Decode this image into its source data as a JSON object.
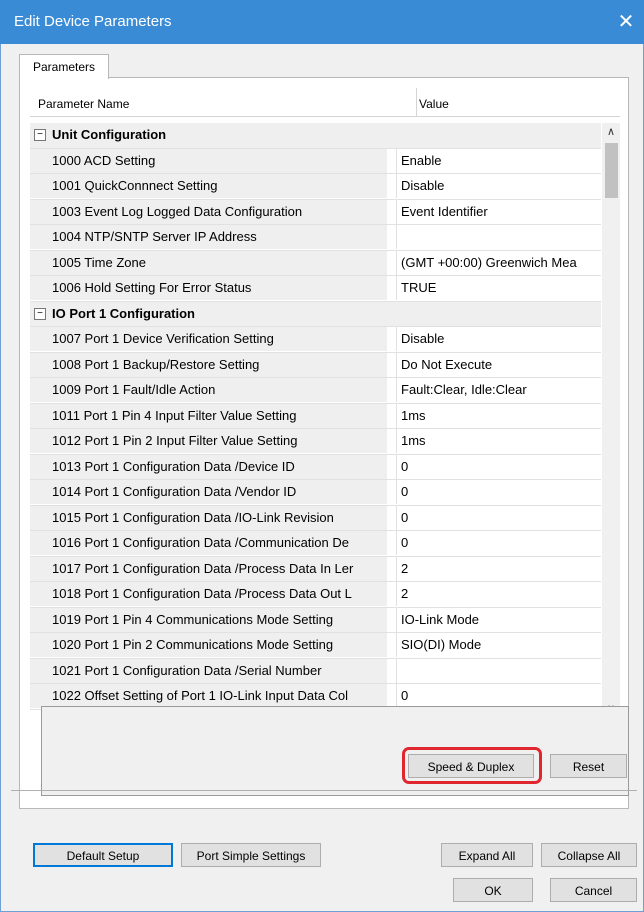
{
  "window": {
    "title": "Edit Device Parameters",
    "close_glyph": "✕"
  },
  "tab": {
    "label": "Parameters"
  },
  "grid": {
    "headers": {
      "name": "Parameter Name",
      "value": "Value"
    },
    "groups": [
      {
        "label": "Unit Configuration",
        "toggle": "−",
        "rows": [
          {
            "name": "1000 ACD Setting",
            "value": "Enable"
          },
          {
            "name": "1001 QuickConnnect Setting",
            "value": "Disable"
          },
          {
            "name": "1003 Event Log Logged Data Configuration",
            "value": "Event Identifier"
          },
          {
            "name": "1004 NTP/SNTP Server IP Address",
            "value": ""
          },
          {
            "name": "1005 Time Zone",
            "value": "(GMT +00:00) Greenwich Mea"
          },
          {
            "name": "1006 Hold Setting For Error Status",
            "value": "TRUE"
          }
        ]
      },
      {
        "label": "IO Port 1 Configuration",
        "toggle": "−",
        "rows": [
          {
            "name": "1007 Port 1 Device Verification Setting",
            "value": "Disable"
          },
          {
            "name": "1008 Port 1 Backup/Restore Setting",
            "value": "Do Not Execute"
          },
          {
            "name": "1009 Port 1 Fault/Idle Action",
            "value": "Fault:Clear, Idle:Clear"
          },
          {
            "name": "1011 Port 1 Pin 4 Input Filter Value Setting",
            "value": "1ms"
          },
          {
            "name": "1012 Port 1 Pin 2 Input Filter Value Setting",
            "value": "1ms"
          },
          {
            "name": "1013 Port 1 Configuration Data /Device ID",
            "value": "0"
          },
          {
            "name": "1014 Port 1 Configuration Data /Vendor ID",
            "value": "0"
          },
          {
            "name": "1015 Port 1 Configuration Data /IO-Link Revision",
            "value": "0"
          },
          {
            "name": "1016 Port 1 Configuration Data /Communication De",
            "value": "0"
          },
          {
            "name": "1017 Port 1 Configuration Data /Process Data In Ler",
            "value": "2"
          },
          {
            "name": "1018 Port 1 Configuration Data /Process Data Out L",
            "value": "2"
          },
          {
            "name": "1019 Port 1 Pin 4 Communications Mode Setting",
            "value": "IO-Link Mode"
          },
          {
            "name": "1020 Port 1 Pin 2 Communications Mode Setting",
            "value": "SIO(DI) Mode"
          },
          {
            "name": "1021 Port 1 Configuration Data /Serial Number",
            "value": ""
          },
          {
            "name": "1022 Offset Setting of Port 1 IO-Link Input Data Col",
            "value": "0"
          }
        ]
      }
    ]
  },
  "scrollbar": {
    "up_glyph": "∧",
    "down_glyph": "∨"
  },
  "buttons": {
    "speed_duplex": "Speed & Duplex",
    "reset": "Reset",
    "default_setup": "Default Setup",
    "port_simple_settings": "Port Simple Settings",
    "expand_all": "Expand All",
    "collapse_all": "Collapse All",
    "ok": "OK",
    "cancel": "Cancel"
  },
  "colors": {
    "titlebar": "#3a8bd6",
    "highlight_ring": "#e0262e",
    "group_row": "#efefef",
    "focus_border": "#0078d7"
  }
}
